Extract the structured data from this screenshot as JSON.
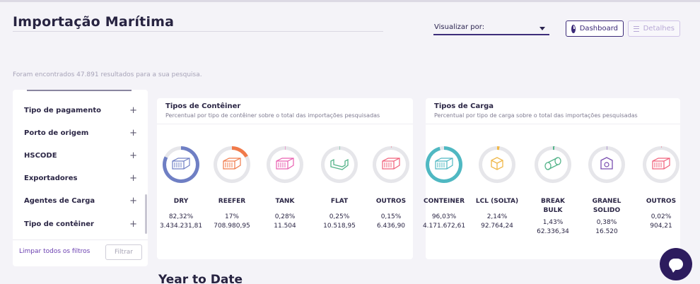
{
  "header": {
    "title": "Importação Marítima",
    "view_by_label": "Visualizar por:",
    "dashboard_label": "Dashboard",
    "details_label": "Detalhes"
  },
  "results_text": "Foram encontrados 47.891 resultados para a sua pesquisa.",
  "sidebar": {
    "items": [
      {
        "label": "Tipo de pagamento",
        "plus": "+"
      },
      {
        "label": "Porto de origem",
        "plus": "+"
      },
      {
        "label": "HSCODE",
        "plus": "+"
      },
      {
        "label": "Exportadores",
        "plus": "+"
      },
      {
        "label": "Agentes de Carga",
        "plus": "+"
      },
      {
        "label": "Tipo de contêiner",
        "plus": "+"
      }
    ],
    "clear_label": "Limpar todos os filtros",
    "filter_label": "Filtrar"
  },
  "container_card": {
    "title": "Tipos de Contêiner",
    "subtitle": "Percentual por tipo de contêiner sobre o total das importações pesquisadas",
    "items": [
      {
        "label": "DRY",
        "percent": "82,32%",
        "value": "3.434.231,81",
        "fraction": 0.8232,
        "color": "#6f7fc4",
        "icon": "dry-container-icon"
      },
      {
        "label": "REEFER",
        "percent": "17%",
        "value": "708.980,95",
        "fraction": 0.17,
        "color": "#f07a4a",
        "icon": "reefer-container-icon"
      },
      {
        "label": "TANK",
        "percent": "0,28%",
        "value": "11.504",
        "fraction": 0.0028,
        "color": "#e95fb0",
        "icon": "tank-container-icon"
      },
      {
        "label": "FLAT",
        "percent": "0,25%",
        "value": "10.518,95",
        "fraction": 0.0025,
        "color": "#55b48a",
        "icon": "flat-container-icon"
      },
      {
        "label": "OUTROS",
        "percent": "0,15%",
        "value": "6.436,90",
        "fraction": 0.0015,
        "color": "#f0607a",
        "icon": "other-container-icon"
      }
    ]
  },
  "cargo_card": {
    "title": "Tipos de Carga",
    "subtitle": "Percentual por tipo de carga sobre o total das importações pesquisadas",
    "items": [
      {
        "label": "CONTEINER",
        "percent": "96,03%",
        "value": "4.171.672,61",
        "fraction": 0.9603,
        "color": "#4fb8c2",
        "icon": "container-cargo-icon"
      },
      {
        "label": "LCL (SOLTA)",
        "percent": "2,14%",
        "value": "92.764,24",
        "fraction": 0.0214,
        "color": "#f0b84a",
        "icon": "lcl-box-icon"
      },
      {
        "label": "BREAK BULK",
        "percent": "1,43%",
        "value": "62.336,34",
        "fraction": 0.0143,
        "color": "#55b48a",
        "icon": "break-bulk-icon"
      },
      {
        "label": "GRANEL SOLIDO",
        "percent": "0,38%",
        "value": "16.520",
        "fraction": 0.0038,
        "color": "#7a4fb0",
        "icon": "bulk-solid-icon"
      },
      {
        "label": "OUTROS",
        "percent": "0,02%",
        "value": "904,21",
        "fraction": 0.0002,
        "color": "#f0607a",
        "icon": "other-cargo-icon"
      }
    ]
  },
  "section_title": "Year to Date",
  "colors": {
    "accent": "#3b2a78",
    "ring_track": "#e6e6ea"
  }
}
